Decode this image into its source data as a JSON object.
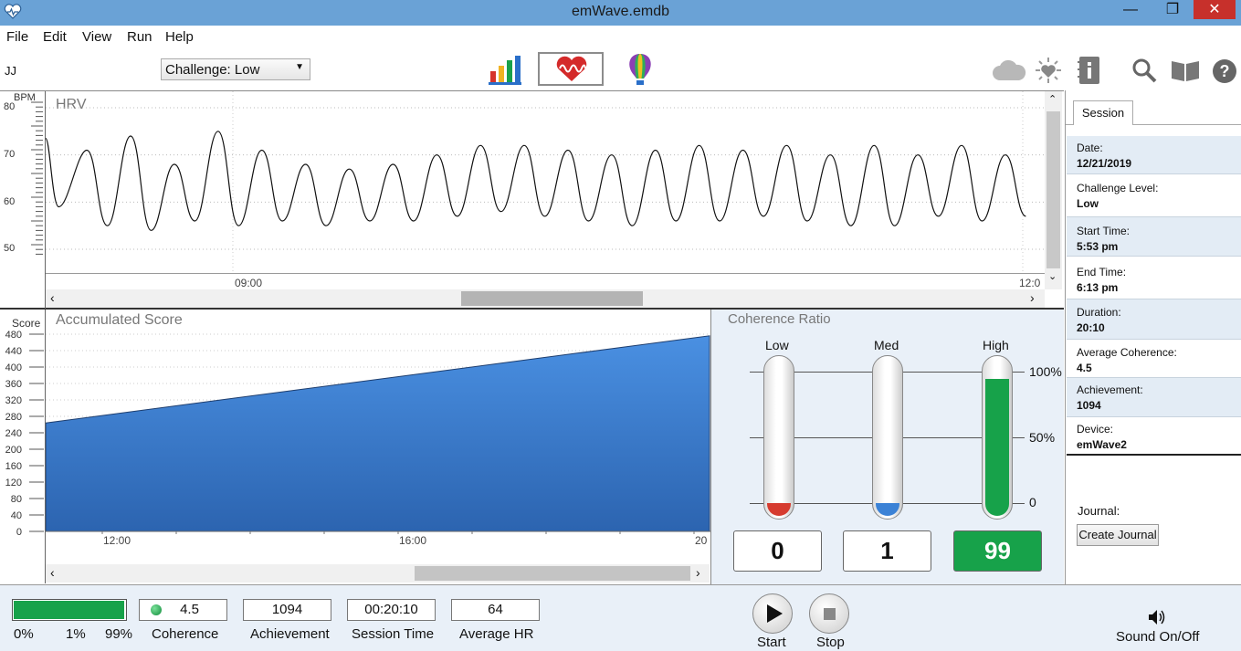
{
  "window": {
    "title": "emWave.emdb",
    "minimize": "—",
    "maximize": "❐",
    "close": "✕"
  },
  "menu": [
    "File",
    "Edit",
    "View",
    "Run",
    "Help"
  ],
  "toolbar": {
    "user": "JJ",
    "challenge": "Challenge: Low"
  },
  "hrv": {
    "title": "HRV",
    "unit": "BPM",
    "yticks": [
      "80",
      "70",
      "60",
      "50"
    ],
    "xticks": [
      "09:00",
      "12:0"
    ],
    "ylim": [
      45,
      82
    ],
    "peaks": [
      74,
      71,
      74,
      68,
      75,
      71,
      68,
      67,
      68,
      70,
      72,
      72,
      71,
      70,
      71,
      72,
      71,
      72,
      70,
      72,
      70,
      72,
      70
    ],
    "troughs": [
      59,
      55,
      54,
      56,
      55,
      56,
      55,
      56,
      56,
      57,
      58,
      57,
      56,
      55,
      56,
      56,
      57,
      56,
      55,
      55,
      57,
      56,
      57
    ]
  },
  "score": {
    "title": "Accumulated Score",
    "unit": "Score",
    "yticks": [
      "480",
      "440",
      "400",
      "360",
      "320",
      "280",
      "240",
      "200",
      "160",
      "120",
      "80",
      "40",
      "0"
    ],
    "xticks": [
      "12:00",
      "16:00",
      "20"
    ],
    "start": 264,
    "end": 476
  },
  "coherence": {
    "title": "Coherence Ratio",
    "columns": [
      {
        "label": "Low",
        "value": "0",
        "pct": 0
      },
      {
        "label": "Med",
        "value": "1",
        "pct": 1
      },
      {
        "label": "High",
        "value": "99",
        "pct": 99
      }
    ],
    "scale": [
      "100%",
      "50%",
      "0"
    ]
  },
  "session": {
    "tab": "Session",
    "fields": [
      {
        "key": "Date:",
        "value": "12/21/2019"
      },
      {
        "key": "Challenge Level:",
        "value": "Low"
      },
      {
        "key": "Start Time:",
        "value": "5:53 pm"
      },
      {
        "key": "End Time:",
        "value": "6:13 pm"
      },
      {
        "key": "Duration:",
        "value": "20:10"
      },
      {
        "key": "Average Coherence:",
        "value": "4.5"
      },
      {
        "key": "Achievement:",
        "value": "1094"
      },
      {
        "key": "Device:",
        "value": "emWave2"
      }
    ],
    "journal_label": "Journal:",
    "create_journal": "Create Journal"
  },
  "status": {
    "progress_labels": [
      "0%",
      "1%",
      "99%"
    ],
    "coherence_value": "4.5",
    "coherence_label": "Coherence",
    "achievement_value": "1094",
    "achievement_label": "Achievement",
    "session_time_value": "00:20:10",
    "session_time_label": "Session Time",
    "avg_hr_value": "64",
    "avg_hr_label": "Average HR",
    "start_label": "Start",
    "stop_label": "Stop",
    "sound_label": "Sound On/Off"
  },
  "colors": {
    "accent": "#6aa2d6",
    "score_fill": "#3a7dcf",
    "coherence_high": "#17a24a",
    "coherence_med": "#3b82d6",
    "coherence_low": "#d63b2f"
  }
}
